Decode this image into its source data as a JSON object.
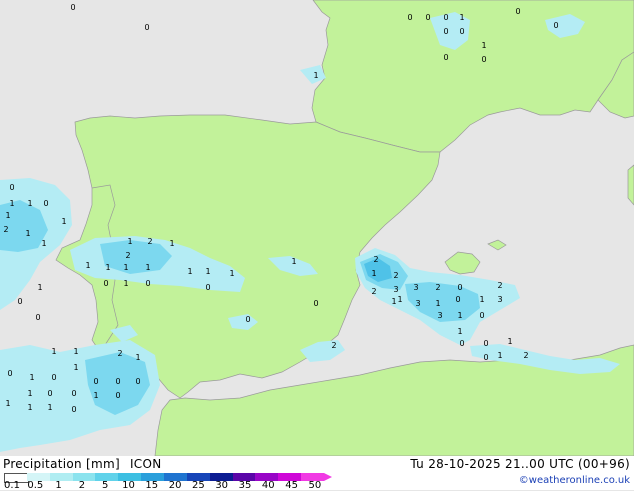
{
  "title": "Precipitation [mm]",
  "model": "ICON",
  "validity": "Tu 28-10-2025 21..00 UTC (00+96)",
  "credit": "©weatheronline.co.uk",
  "legend": {
    "ticks": [
      "0.1",
      "0.5",
      "1",
      "2",
      "5",
      "10",
      "15",
      "20",
      "25",
      "30",
      "35",
      "40",
      "45",
      "50"
    ],
    "colors": [
      "#ffffff",
      "#d4f5f7",
      "#b0edf2",
      "#8be3ee",
      "#60d2ea",
      "#3cbfe2",
      "#2a9fdb",
      "#1f74d0",
      "#1645b8",
      "#0c1d92",
      "#5a06a8",
      "#9805c7",
      "#cf07d8",
      "#f13ae4"
    ]
  },
  "colors": {
    "sea": "#e6e6e6",
    "land": "#c2f29a",
    "border": "#9a9a9a",
    "rain_light": "#b4ecf4",
    "rain_medium": "#7cd8ef",
    "rain_heavy": "#4fc2e8"
  },
  "rain_labels": [
    "0",
    "0",
    "0",
    "0",
    "0",
    "1",
    "0",
    "0",
    "0",
    "0",
    "1",
    "0",
    "1",
    "0",
    "0",
    "1",
    "1",
    "0",
    "1",
    "1",
    "2",
    "1",
    "1",
    "1",
    "2",
    "2",
    "1",
    "1",
    "1",
    "1",
    "1",
    "1",
    "1",
    "1",
    "0",
    "1",
    "0",
    "0",
    "1",
    "0",
    "0",
    "0",
    "0",
    "1",
    "2",
    "1",
    "2",
    "3",
    "2",
    "0",
    "2",
    "3",
    "3",
    "1",
    "0",
    "1",
    "3",
    "3",
    "1",
    "0",
    "1",
    "2",
    "1",
    "1",
    "0",
    "0",
    "1",
    "2",
    "1",
    "0",
    "1",
    "1",
    "2",
    "1",
    "0",
    "1",
    "0",
    "1",
    "0",
    "0",
    "0",
    "1",
    "0",
    "0",
    "1",
    "0",
    "1",
    "1",
    "1",
    "0",
    "2"
  ]
}
